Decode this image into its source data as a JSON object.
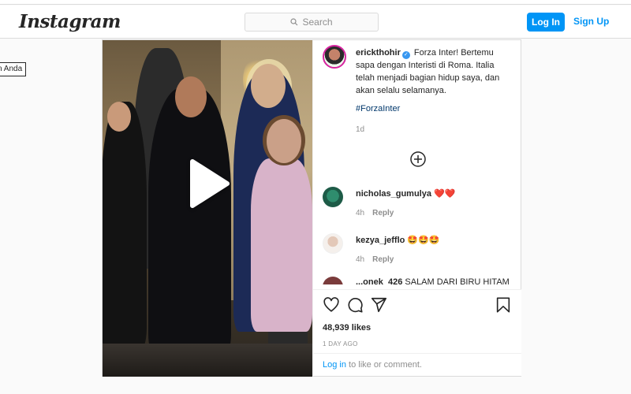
{
  "header": {
    "logo": "Instagram",
    "search_placeholder": "Search",
    "login_label": "Log In",
    "signup_label": "Sign Up"
  },
  "tooltip": "n Anda",
  "post": {
    "author": "erickthohir",
    "caption": "Forza Inter! Bertemu sapa dengan Interisti di Roma. Italia telah menjadi bagian hidup saya, dan akan selalu selamanya.",
    "hashtag": "#ForzaInter",
    "caption_time": "1d",
    "comments": [
      {
        "user": "nicholas_gumulya",
        "text": "❤️❤️",
        "time": "4h",
        "reply_label": "Reply"
      },
      {
        "user": "kezya_jefflo",
        "text": "🤩🤩🤩",
        "time": "4h",
        "reply_label": "Reply"
      },
      {
        "user": "...onek_426",
        "text": "SALAM DARI BIRU HITAM"
      }
    ],
    "likes": "48,939 likes",
    "date": "1 DAY AGO",
    "login_link": "Log in",
    "login_suffix": " to like or comment."
  },
  "colors": {
    "accent": "#0095f6",
    "hashtag": "#00376b",
    "muted": "#8e8e8e",
    "verified": "#3897f0"
  },
  "icons": [
    "search-icon",
    "verified-icon",
    "play-icon",
    "plus-circle-icon",
    "heart-icon",
    "comment-icon",
    "share-icon",
    "bookmark-icon"
  ]
}
